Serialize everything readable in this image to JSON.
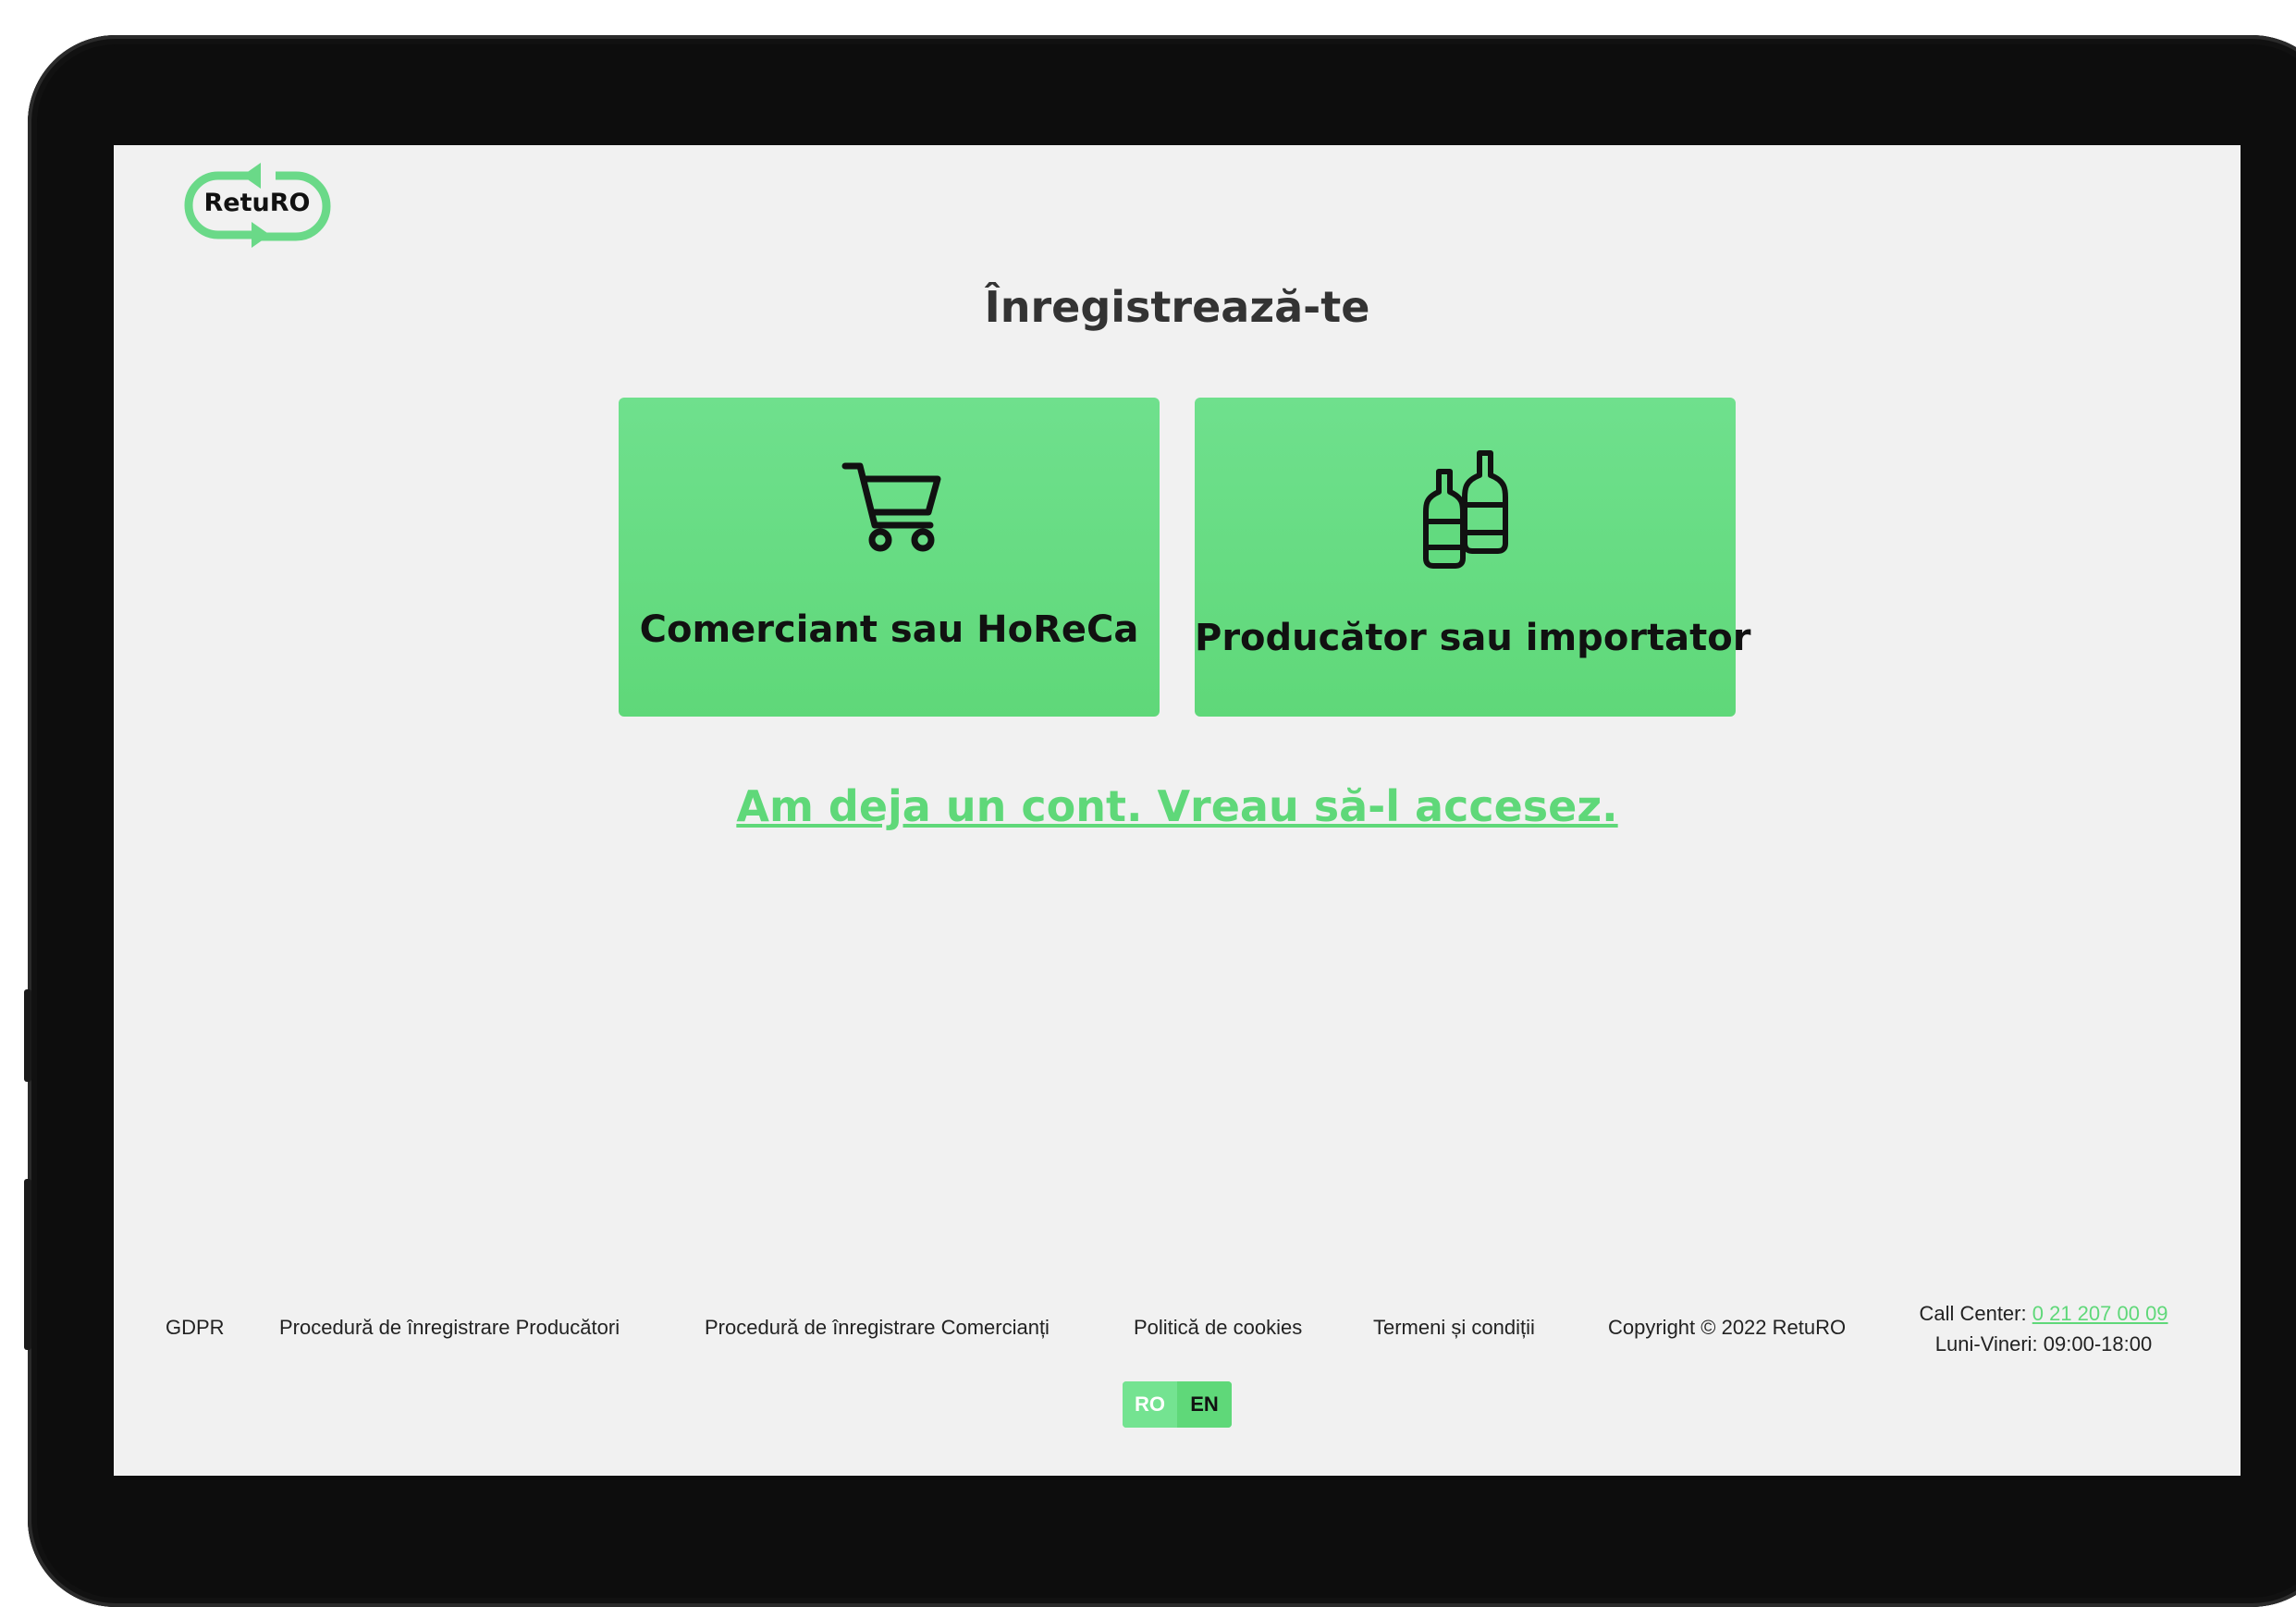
{
  "brand": {
    "name": "RetuRO",
    "accent_color": "#5fd879"
  },
  "page": {
    "title": "Înregistrează-te"
  },
  "cards": [
    {
      "label": "Comerciant sau HoReCa",
      "icon": "shopping-cart-icon"
    },
    {
      "label": "Producător sau importator",
      "icon": "bottles-icon"
    }
  ],
  "login_link": "Am deja un cont. Vreau să-l accesez.",
  "footer": {
    "links": [
      "GDPR",
      "Procedură de înregistrare Producători",
      "Procedură de înregistrare Comercianți",
      "Politică de cookies",
      "Termeni și condiții"
    ],
    "copyright": "Copyright © 2022 RetuRO",
    "call_center_label": "Call Center:",
    "call_center_phone": "0 21 207 00 09",
    "hours": "Luni-Vineri: 09:00-18:00"
  },
  "language": {
    "options": [
      "RO",
      "EN"
    ],
    "selected": "RO"
  }
}
